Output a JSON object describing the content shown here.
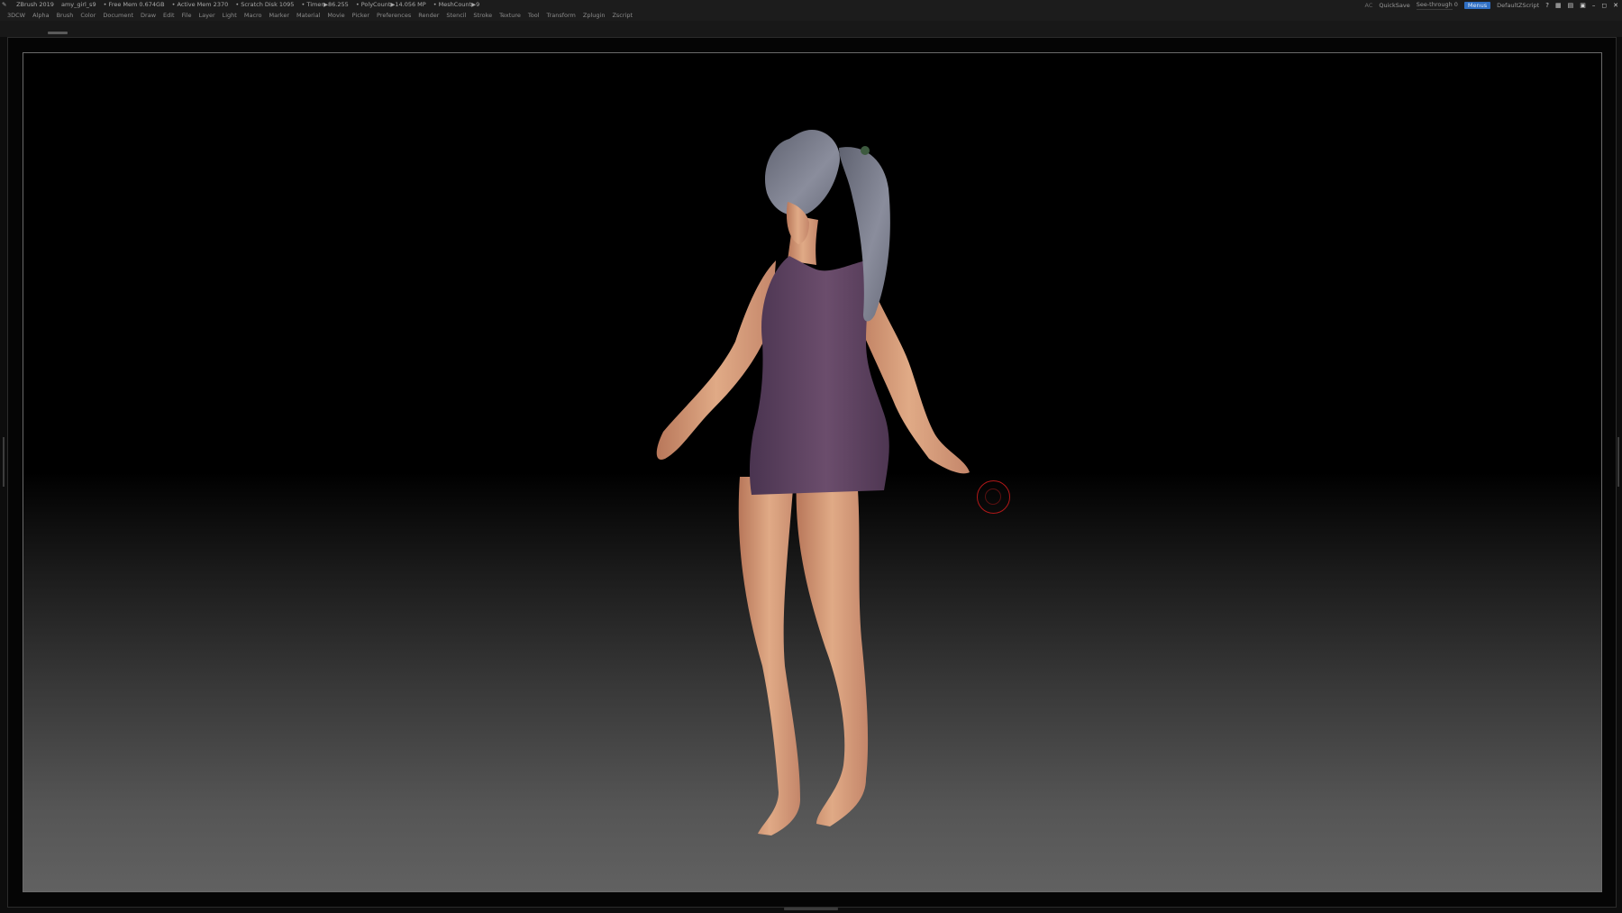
{
  "titlebar": {
    "app": "ZBrush 2019",
    "file": "amy_girl_s9",
    "free_mem": "• Free Mem 0.674GB",
    "active_mem": "• Active Mem 2370",
    "scratch_disk": "• Scratch Disk 1095",
    "timer": "• Timer▶86.255",
    "polycount": "• PolyCount▶14.056 MP",
    "meshcount": "• MeshCount▶9",
    "ac": "AC",
    "quicksave": "QuickSave",
    "see_through": "See-through 0",
    "see_through_level": 0,
    "menus": "Menus",
    "script": "DefaultZScript"
  },
  "menubar": {
    "items": [
      "3DCW",
      "Alpha",
      "Brush",
      "Color",
      "Document",
      "Draw",
      "Edit",
      "File",
      "Layer",
      "Light",
      "Macro",
      "Marker",
      "Material",
      "Movie",
      "Picker",
      "Preferences",
      "Render",
      "Stencil",
      "Stroke",
      "Texture",
      "Tool",
      "Transform",
      "Zplugin",
      "Zscript"
    ]
  },
  "icons": {
    "app": "zbrush-logo-icon",
    "window_controls": [
      "help-icon",
      "layout-icon",
      "script-icon",
      "lock-icon",
      "minimize-icon",
      "restore-icon",
      "close-icon"
    ]
  },
  "colors": {
    "accent": "#2f6fc4",
    "dress": "#5a3f5c",
    "skin": "#d9a07e",
    "hair": "#7c8090",
    "cursor": "#b01818"
  }
}
